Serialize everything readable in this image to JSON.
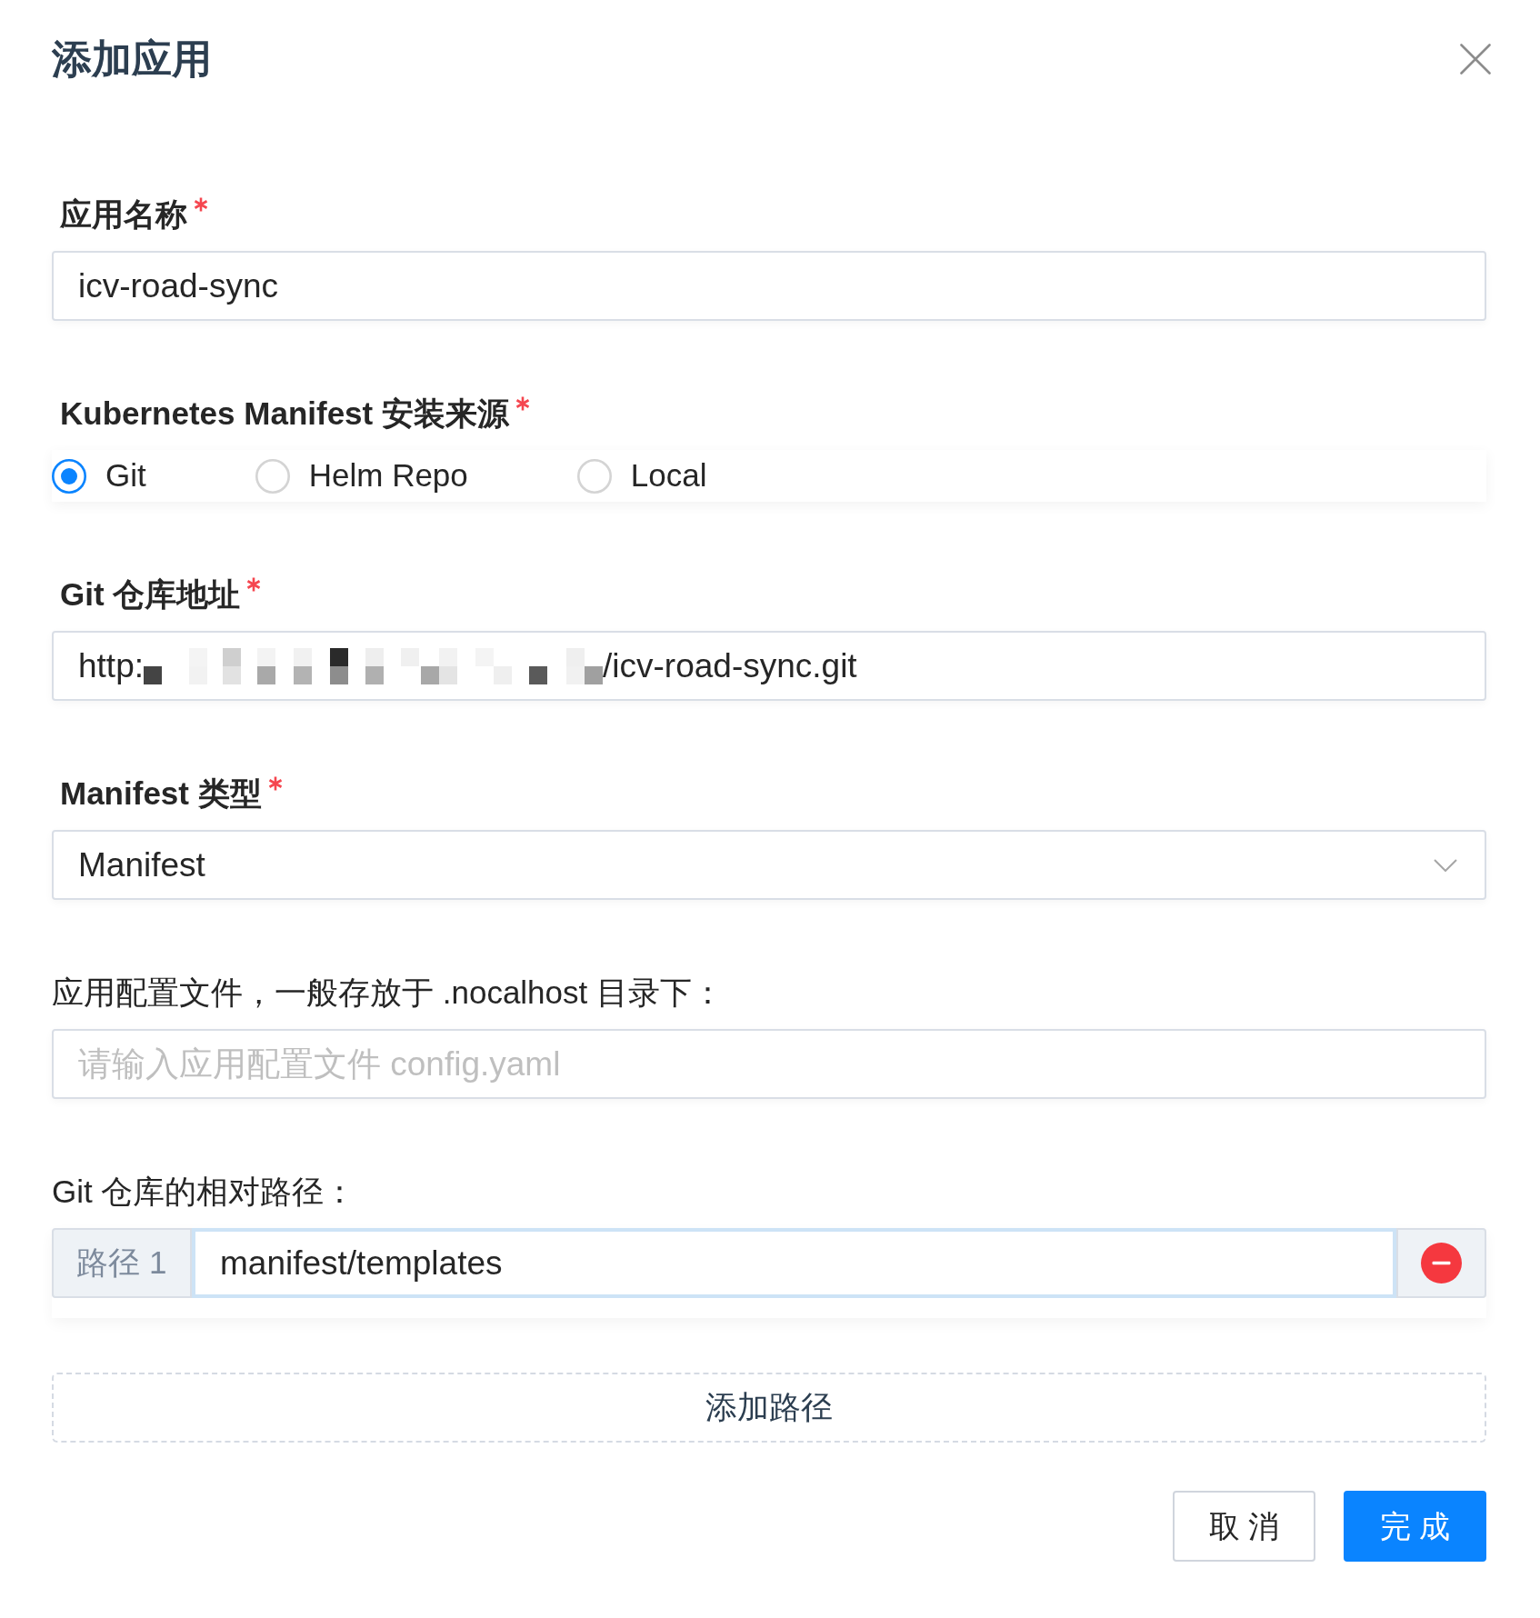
{
  "dialog": {
    "title": "添加应用"
  },
  "fields": [
    {
      "kind": "text",
      "label": "应用名称",
      "required": true,
      "value": "icv-road-sync"
    },
    {
      "kind": "radio",
      "label": "Kubernetes Manifest 安装来源",
      "required": true,
      "options": [
        {
          "label": "Git",
          "selected": true
        },
        {
          "label": "Helm Repo",
          "selected": false
        },
        {
          "label": "Local",
          "selected": false
        }
      ]
    },
    {
      "kind": "url",
      "label": "Git 仓库地址",
      "required": true,
      "value_start": "http:",
      "redacted": true,
      "value_end": "/icv-road-sync.git"
    },
    {
      "kind": "select",
      "label": "Manifest 类型",
      "required": true,
      "value": "Manifest"
    },
    {
      "kind": "text",
      "label": "应用配置文件，一般存放于 .nocalhost 目录下：",
      "required": false,
      "placeholder": "请输入应用配置文件 config.yaml"
    },
    {
      "kind": "paths",
      "label": "Git 仓库的相对路径：",
      "required": false,
      "rows": [
        {
          "addon": "路径 1",
          "value": "manifest/templates",
          "focused": true
        }
      ],
      "add_button": "添加路径"
    }
  ],
  "buttons": [
    {
      "kind": "default",
      "label": "取 消"
    },
    {
      "kind": "primary",
      "label": "完 成"
    }
  ]
}
